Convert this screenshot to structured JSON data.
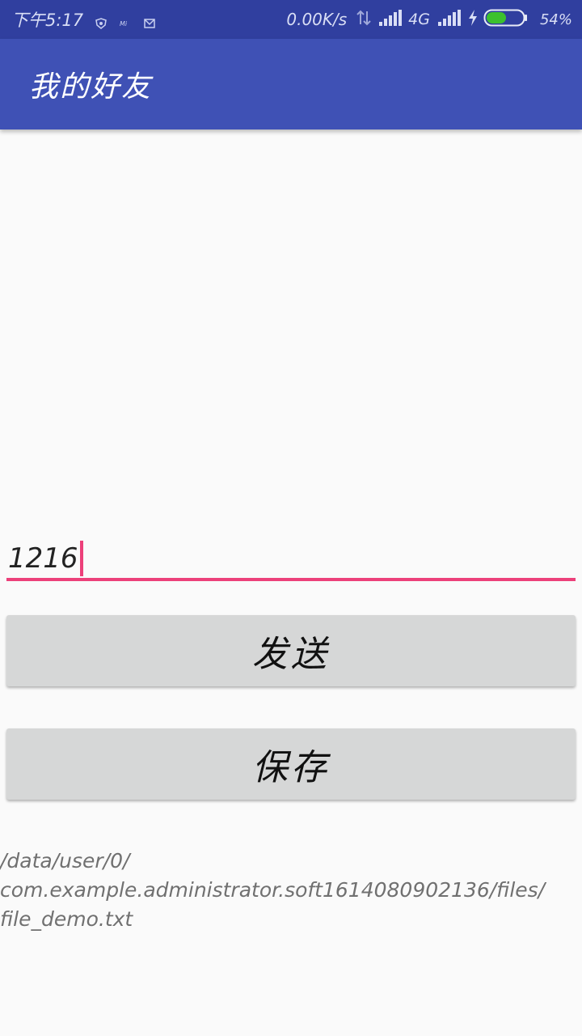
{
  "status_bar": {
    "time": "下午5:17",
    "net_speed": "0.00K/s",
    "network_type": "4G",
    "battery_percent": "54%",
    "battery_level": 0.54,
    "notification_icons": [
      "shield-icon",
      "mi-icon",
      "mail-icon"
    ]
  },
  "app_bar": {
    "title": "我的好友",
    "color": "#3f51b5"
  },
  "input": {
    "value": "1216",
    "accent_color": "#ec407a"
  },
  "buttons": {
    "send_label": "发送",
    "save_label": "保存"
  },
  "output": {
    "path_line1": "/data/user/0/",
    "path_line2": "com.example.administrator.soft1614080902136/files/",
    "path_line3": "file_demo.txt"
  }
}
